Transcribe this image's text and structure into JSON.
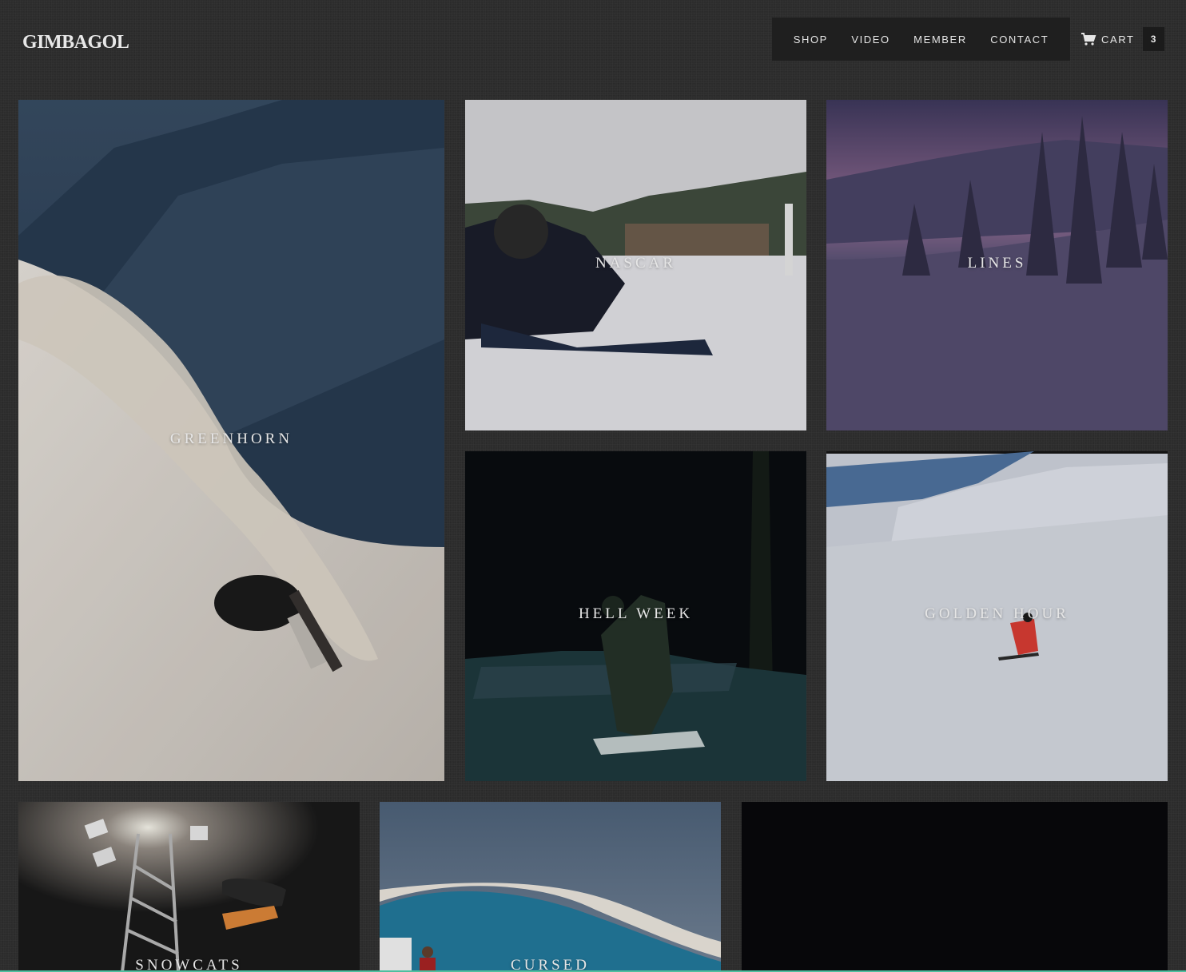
{
  "header": {
    "logo": "GIMBAGOL",
    "nav": [
      "SHOP",
      "VIDEO",
      "MEMBER",
      "CONTACT"
    ],
    "cart_label": "CART",
    "cart_count": "3"
  },
  "videos": [
    {
      "title": "GREENHORN"
    },
    {
      "title": "NASCAR"
    },
    {
      "title": "LINES"
    },
    {
      "title": "HELL WEEK"
    },
    {
      "title": "GOLDEN HOUR"
    },
    {
      "title": "SNOWCATS"
    },
    {
      "title": "CURSED"
    },
    {
      "title": ""
    }
  ],
  "icons": {
    "cart": "cart-icon"
  },
  "colors": {
    "background": "#2c2c2c",
    "nav_bg": "#1f1f1f",
    "text": "#e6e6e6",
    "accent_line": "#4fbf9f"
  }
}
